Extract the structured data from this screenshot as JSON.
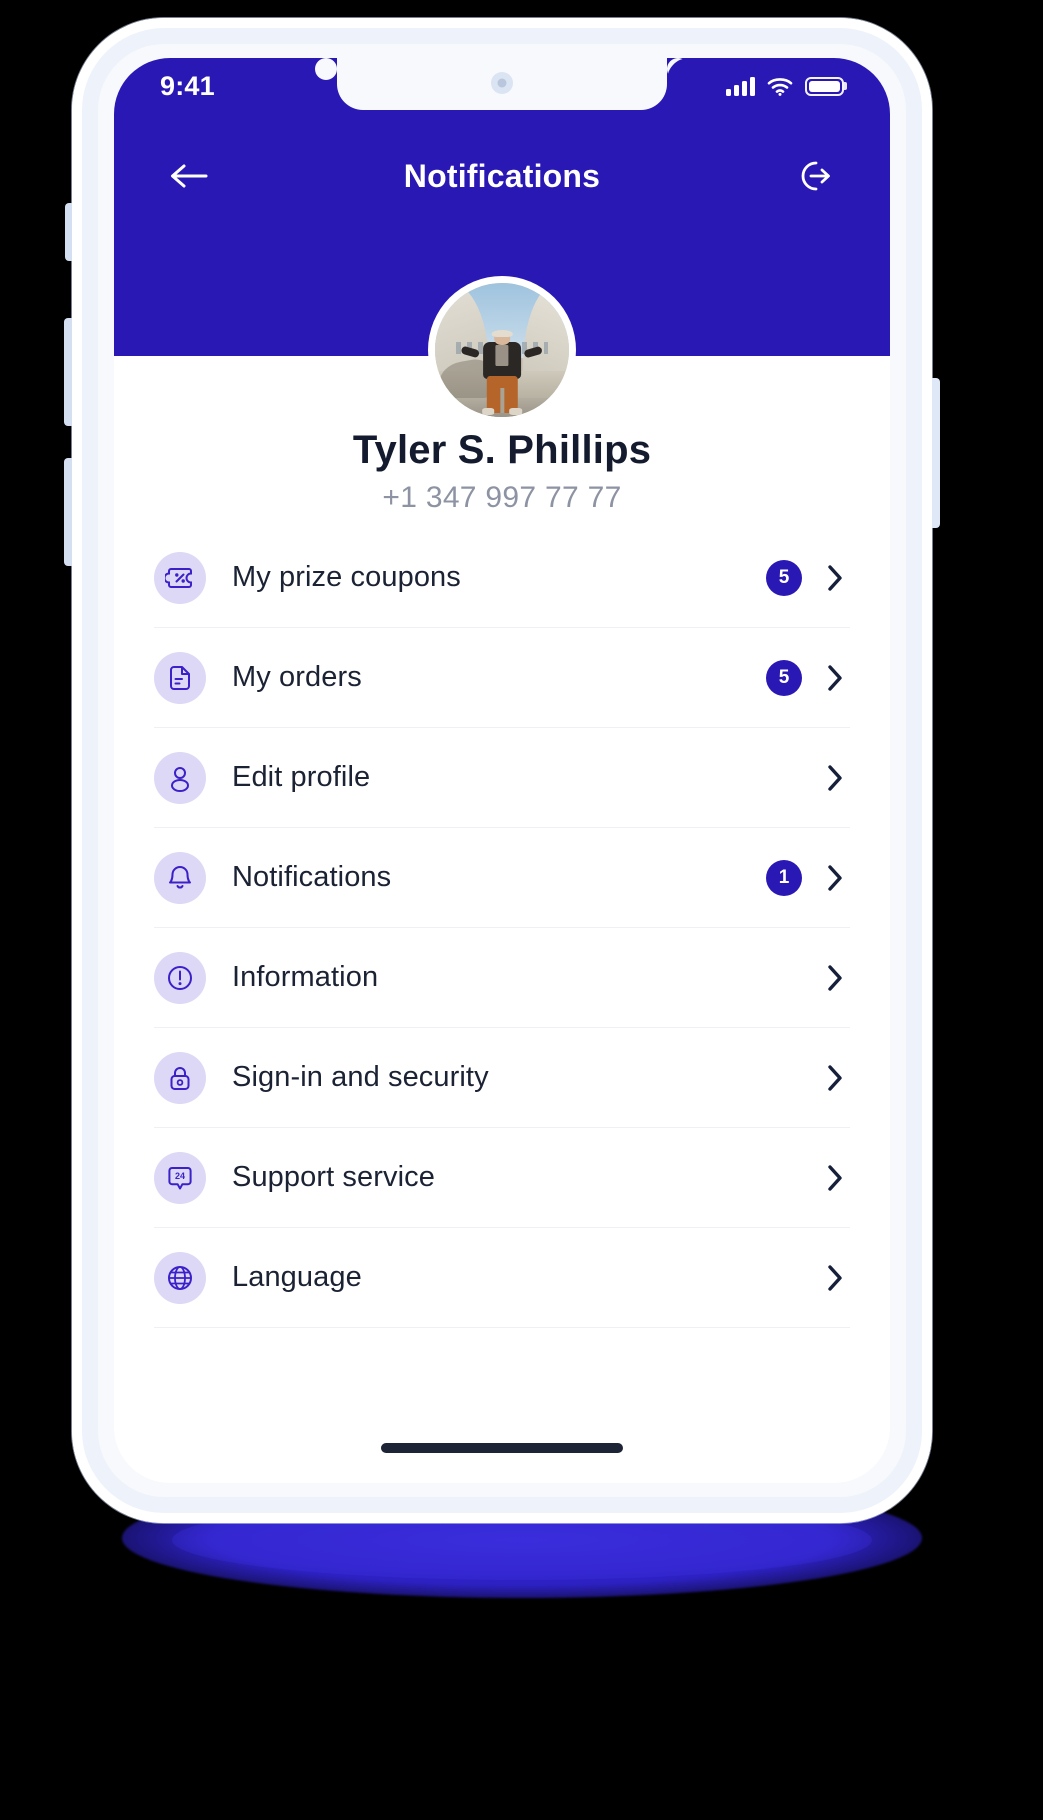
{
  "statusbar": {
    "time": "9:41",
    "signal_icon": "cellular-signal-icon",
    "wifi_icon": "wifi-icon",
    "battery_icon": "battery-icon"
  },
  "navbar": {
    "back_icon": "arrow-left-icon",
    "title": "Notifications",
    "logout_icon": "logout-icon"
  },
  "profile": {
    "avatar_alt": "user-avatar-photo",
    "name": "Tyler S. Phillips",
    "phone": "+1 347 997 77 77"
  },
  "theme": {
    "header_blue": "#2a18b4",
    "badge_blue": "#2a18b4",
    "icon_circle": "#ddd8f5",
    "icon_stroke": "#3a21c9",
    "text_dark": "#1b2234",
    "text_muted": "#8d93a3",
    "divider": "#eef0f5",
    "bezel": "#f7f9fc",
    "shadow_blue": "#2d21c4",
    "page_bg": "#000000"
  },
  "menu": {
    "items": [
      {
        "label": "My prize coupons",
        "icon": "coupon-percent-icon",
        "badge": "5",
        "has_badge": true
      },
      {
        "label": "My orders",
        "icon": "document-icon",
        "badge": "5",
        "has_badge": true
      },
      {
        "label": "Edit profile",
        "icon": "user-icon",
        "badge": "",
        "has_badge": false
      },
      {
        "label": "Notifications",
        "icon": "bell-icon",
        "badge": "1",
        "has_badge": true
      },
      {
        "label": "Information",
        "icon": "info-exclamation-icon",
        "badge": "",
        "has_badge": false
      },
      {
        "label": "Sign-in and security",
        "icon": "lock-icon",
        "badge": "",
        "has_badge": false
      },
      {
        "label": "Support service",
        "icon": "support-24-icon",
        "badge": "",
        "has_badge": false
      },
      {
        "label": "Language",
        "icon": "globe-icon",
        "badge": "",
        "has_badge": false
      }
    ],
    "chevron_icon": "chevron-right-icon"
  },
  "device": {
    "home_indicator": "home-indicator-bar",
    "camera_icon": "front-camera-dot",
    "buttons": [
      "silence-switch",
      "volume-up-button",
      "volume-down-button",
      "power-button"
    ]
  }
}
